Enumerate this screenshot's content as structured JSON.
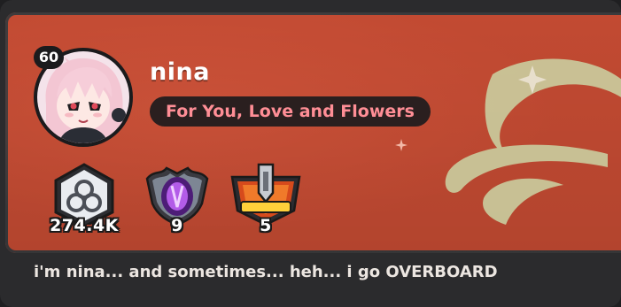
{
  "profile": {
    "level": "60",
    "username": "nina",
    "title": "For You, Love and Flowers",
    "bio": "i'm nina... and sometimes... heh... i go OVERBOARD",
    "avatar_icon": "anime-girl-avatar"
  },
  "badges": [
    {
      "icon": "knot-hexagon-icon",
      "count": "274.4K"
    },
    {
      "icon": "purple-shield-crest-icon",
      "count": "9"
    },
    {
      "icon": "red-shield-sword-emblem-icon",
      "count": "5"
    }
  ],
  "colors": {
    "card_background": "#c24a32",
    "frame_background": "#2b2b2d",
    "title_text": "#ff8e96",
    "title_pill": "#2a1f1f",
    "background_art": "#c9c79a"
  }
}
